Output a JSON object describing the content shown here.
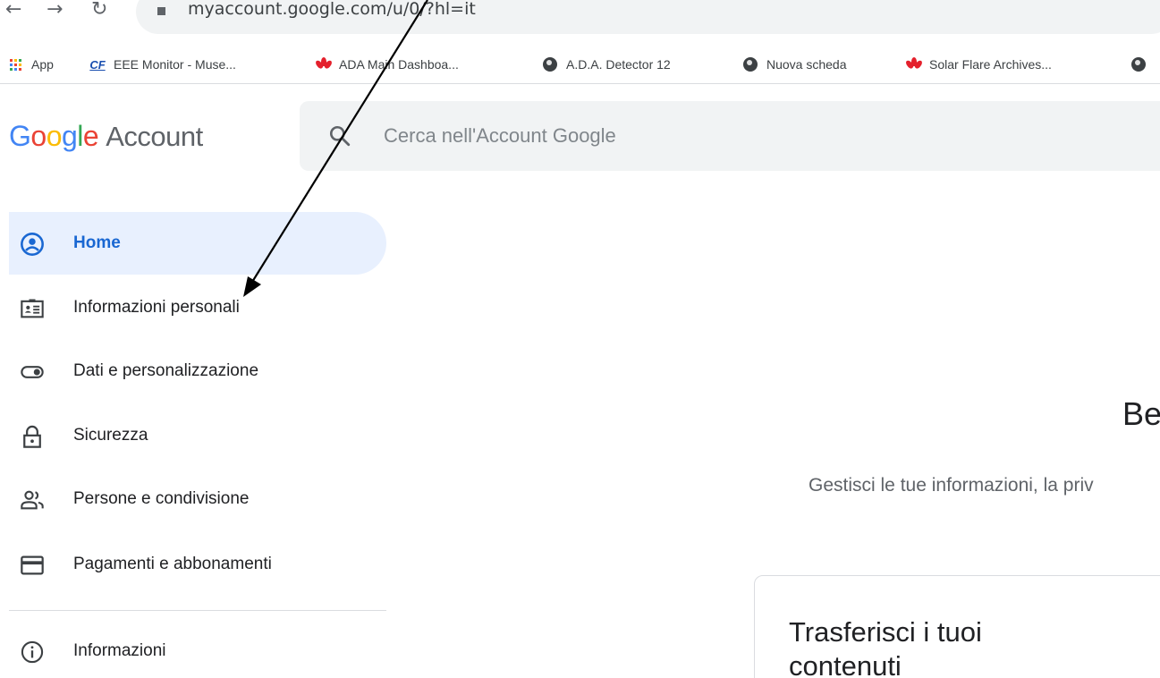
{
  "browser": {
    "url": "myaccount.google.com/u/0/?hl=it",
    "bookmarks": [
      {
        "label": "App",
        "icon": "apps-grid-icon"
      },
      {
        "label": "EEE Monitor - Muse...",
        "icon": "cf-icon"
      },
      {
        "label": "ADA Main Dashboa...",
        "icon": "huawei-icon"
      },
      {
        "label": "A.D.A. Detector 12",
        "icon": "globe-icon"
      },
      {
        "label": "Nuova scheda",
        "icon": "globe-icon"
      },
      {
        "label": "Solar Flare Archives...",
        "icon": "huawei-icon"
      }
    ]
  },
  "header": {
    "logo_word": "Google",
    "logo_suffix": "Account",
    "search_placeholder": "Cerca nell'Account Google"
  },
  "sidebar": {
    "items": [
      {
        "label": "Home",
        "icon": "account-circle-icon",
        "active": true
      },
      {
        "label": "Informazioni personali",
        "icon": "id-card-icon"
      },
      {
        "label": "Dati e personalizzazione",
        "icon": "toggle-icon"
      },
      {
        "label": "Sicurezza",
        "icon": "lock-icon"
      },
      {
        "label": "Persone e condivisione",
        "icon": "people-icon"
      },
      {
        "label": "Pagamenti e abbonamenti",
        "icon": "credit-card-icon"
      },
      {
        "label": "Informazioni",
        "icon": "info-icon"
      }
    ]
  },
  "main": {
    "welcome_partial": "Be",
    "subtitle_partial": "Gestisci le tue informazioni, la priv",
    "card_title": "Trasferisci i tuoi contenuti"
  },
  "colors": {
    "google_blue": "#4285F4",
    "google_red": "#EA4335",
    "google_yellow": "#FBBC05",
    "google_green": "#34A853",
    "active_bg": "#e8f0fe",
    "active_text": "#1967d2"
  }
}
